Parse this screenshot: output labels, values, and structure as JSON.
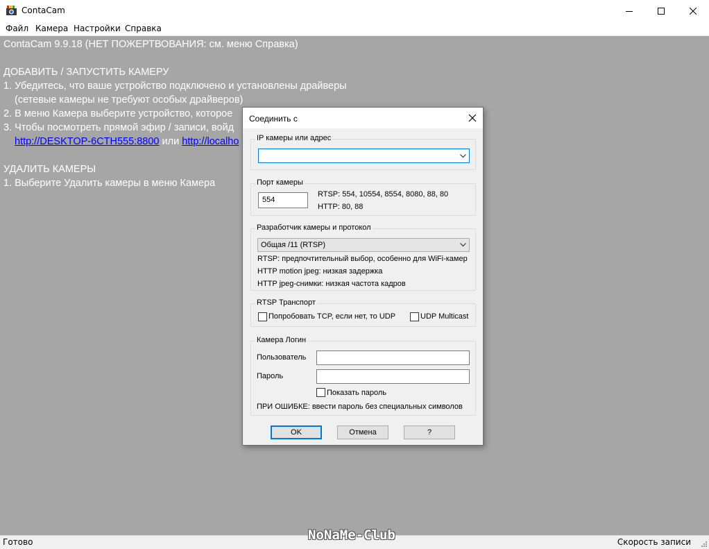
{
  "window": {
    "title": "ContaCam",
    "icon": "contacam-app-icon"
  },
  "menu": [
    "Файл",
    "Камера",
    "Настройки",
    "Справка"
  ],
  "content": {
    "lines": {
      "l1": "ContaCam 9.9.18 (НЕТ ПОЖЕРТВОВАНИЯ: см. меню Справка)",
      "l2": "ДОБАВИТЬ / ЗАПУСТИТЬ КАМЕРУ",
      "l3": "1. Убедитесь, что ваше устройство подключено и установлены драйверы",
      "l4": "(сетевые камеры не требуют особых драйверов)",
      "l5": "2. В меню Камера выберите устройство, которое",
      "l6": "3. Чтобы посмотреть прямой эфир / записи, войд",
      "link1": "http://DESKTOP-6CTH555:8800",
      "or": " или ",
      "link2": "http://localho",
      "l8": "УДАЛИТЬ КАМЕРЫ",
      "l9": "1. Выберите Удалить камеры в меню Камера"
    }
  },
  "status": {
    "left": "Готово",
    "right": "Скорость записи"
  },
  "watermark": "NoNaMe-Club",
  "dialog": {
    "title": "Соединить с",
    "ip_group": {
      "label": "IP камеры или адрес",
      "value": ""
    },
    "port_group": {
      "label": "Порт камеры",
      "value": "554",
      "rtsp_ports": "RTSP: 554, 10554, 8554, 8080, 88, 80",
      "http_ports": "HTTP: 80, 88"
    },
    "vendor_group": {
      "label": "Разработчик камеры и протокол",
      "selected": "Общая /11 (RTSP)",
      "note1": "RTSP: предпочтительный выбор, особенно для WiFi-камер",
      "note2": "HTTP motion jpeg: низкая задержка",
      "note3": "HTTP jpeg-снимки: низкая частота кадров"
    },
    "transport_group": {
      "label": "RTSP Транспорт",
      "tcp_label": "Попробовать TCP, если нет, то UDP",
      "tcp_checked": false,
      "multicast_label": "UDP Multicast",
      "multicast_checked": false
    },
    "login_group": {
      "label": "Камера Логин",
      "user_label": "Пользователь",
      "user_value": "",
      "password_label": "Пароль",
      "password_value": "",
      "show_password_label": "Показать пароль",
      "show_password_checked": false,
      "error_hint": "ПРИ ОШИБКЕ: ввести пароль без специальных символов"
    },
    "buttons": {
      "ok": "OK",
      "cancel": "Отмена",
      "help": "?"
    }
  },
  "colors": {
    "client_bg": "#a6a6a6",
    "link": "#0000ff",
    "focus": "#0078d7"
  }
}
